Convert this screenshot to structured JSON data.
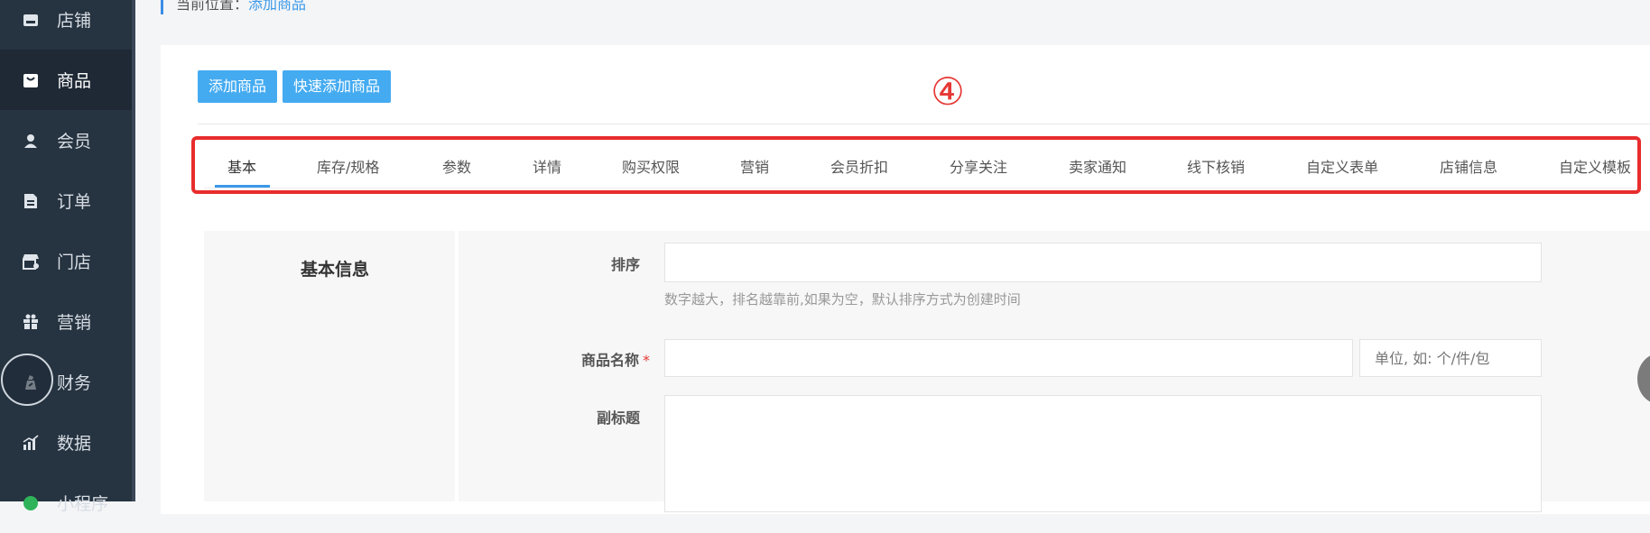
{
  "sidebar": {
    "items": [
      {
        "label": "店铺",
        "icon": "store-icon"
      },
      {
        "label": "商品",
        "icon": "goods-icon"
      },
      {
        "label": "会员",
        "icon": "member-icon"
      },
      {
        "label": "订单",
        "icon": "order-icon"
      },
      {
        "label": "门店",
        "icon": "shop-icon"
      },
      {
        "label": "营销",
        "icon": "gift-icon"
      },
      {
        "label": "财务",
        "icon": "finance-icon"
      },
      {
        "label": "数据",
        "icon": "chart-icon"
      },
      {
        "label": "小程序",
        "icon": "miniapp-icon"
      }
    ],
    "active_index": 1
  },
  "breadcrumb": {
    "prefix": "当前位置：",
    "current": "添加商品"
  },
  "toolbar": {
    "add_label": "添加商品",
    "quick_add_label": "快速添加商品"
  },
  "step_marker": "④",
  "tabs": [
    {
      "label": "基本"
    },
    {
      "label": "库存/规格"
    },
    {
      "label": "参数"
    },
    {
      "label": "详情"
    },
    {
      "label": "购买权限"
    },
    {
      "label": "营销"
    },
    {
      "label": "会员折扣"
    },
    {
      "label": "分享关注"
    },
    {
      "label": "卖家通知"
    },
    {
      "label": "线下核销"
    },
    {
      "label": "自定义表单"
    },
    {
      "label": "店铺信息"
    },
    {
      "label": "自定义模板"
    }
  ],
  "form": {
    "section_title": "基本信息",
    "sort": {
      "label": "排序",
      "value": "",
      "help": "数字越大，排名越靠前,如果为空，默认排序方式为创建时间"
    },
    "name": {
      "label": "商品名称",
      "required_mark": "*",
      "value": "",
      "unit_placeholder": "单位, 如: 个/件/包"
    },
    "subtitle": {
      "label": "副标题",
      "value": ""
    }
  },
  "colors": {
    "accent": "#44abf1",
    "highlight_border": "#e82c2c",
    "sidebar_bg": "#263340"
  }
}
